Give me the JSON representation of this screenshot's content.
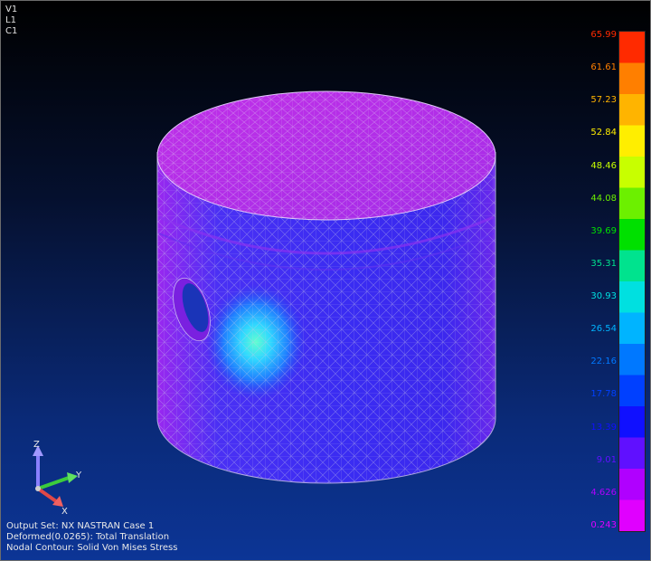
{
  "view_tags": [
    "V1",
    "L1",
    "C1"
  ],
  "legend": {
    "values": [
      "65.99",
      "61.61",
      "57.23",
      "52.84",
      "48.46",
      "44.08",
      "39.69",
      "35.31",
      "30.93",
      "26.54",
      "22.16",
      "17.78",
      "13.39",
      "9.01",
      "4.626",
      "0.243"
    ],
    "colors": [
      "#ff2a00",
      "#ff7f00",
      "#ffb400",
      "#ffee00",
      "#c8ff00",
      "#6cf000",
      "#00e000",
      "#00e38e",
      "#00e0e0",
      "#00b4ff",
      "#0078ff",
      "#0040ff",
      "#1010ff",
      "#6010ff",
      "#b000ff",
      "#e000ff"
    ]
  },
  "triad": {
    "z_label": "Z",
    "y_label": "Y",
    "x_label": "X"
  },
  "footer": {
    "output_set": "Output Set: NX NASTRAN Case 1",
    "deformed": "Deformed(0.0265): Total Translation",
    "contour": "Nodal Contour: Solid Von Mises Stress"
  },
  "colors": {
    "mesh_top": "#b42ce8",
    "mesh_body": "#3c2cf0",
    "hotspot": "#38d8ff",
    "mesh_line": "#c8c8e8"
  }
}
